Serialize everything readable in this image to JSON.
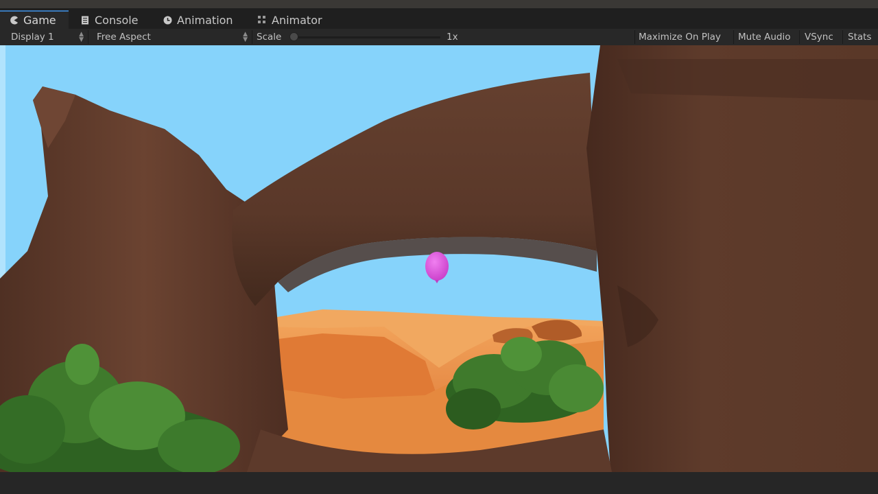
{
  "tabs": [
    {
      "label": "Game",
      "icon": "pacman-icon",
      "active": true
    },
    {
      "label": "Console",
      "icon": "console-icon",
      "active": false
    },
    {
      "label": "Animation",
      "icon": "clock-icon",
      "active": false
    },
    {
      "label": "Animator",
      "icon": "animator-icon",
      "active": false
    }
  ],
  "toolbar": {
    "display": "Display 1",
    "aspect": "Free Aspect",
    "scale_label": "Scale",
    "scale_value": "1x",
    "scale_fraction": 0,
    "maximize_on_play": "Maximize On Play",
    "mute_audio": "Mute Audio",
    "vsync": "VSync",
    "stats": "Stats"
  },
  "scene": {
    "sky_color": "#86d3fb",
    "rock_color": "#5e3b2b",
    "sand_color": "#e88a44",
    "balloon_color": "#e254e2",
    "foliage_color": "#3f7a2c"
  }
}
